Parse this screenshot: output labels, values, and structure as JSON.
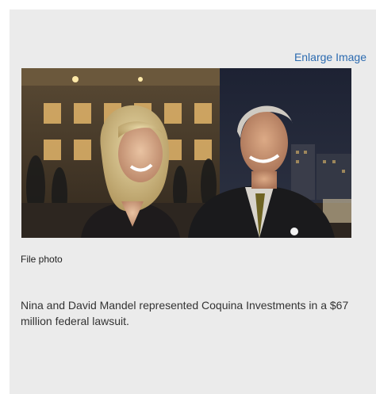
{
  "enlarge_link": {
    "label": "Enlarge Image"
  },
  "photo": {
    "credit": "File photo"
  },
  "caption": {
    "text": "Nina and David Mandel represented Coquina Investments in a $67 million federal lawsuit."
  },
  "colors": {
    "panel_background": "#ebebeb",
    "link": "#2c6bb0",
    "text": "#333333"
  }
}
